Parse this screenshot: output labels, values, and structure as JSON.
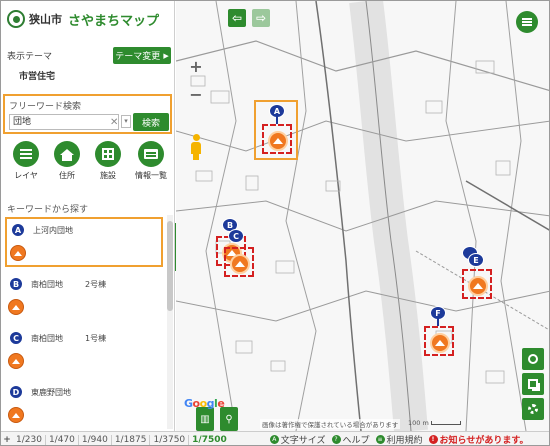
{
  "header": {
    "city_name": "狭山市",
    "map_name": "さやまちマップ"
  },
  "theme": {
    "label": "表示テーマ",
    "value": "市営住宅",
    "change_button": "テーマ変更"
  },
  "search": {
    "title": "フリーワード検索",
    "value": "団地",
    "button": "検索"
  },
  "nav": {
    "items": [
      {
        "label": "レイヤ",
        "icon": "layers-icon"
      },
      {
        "label": "住所",
        "icon": "house-icon"
      },
      {
        "label": "施設",
        "icon": "building-icon"
      },
      {
        "label": "情報一覧",
        "icon": "list-icon"
      }
    ]
  },
  "keyword": {
    "title": "キーワードから探す",
    "results": [
      {
        "marker": "A",
        "name": "上河内団地",
        "number": ""
      },
      {
        "marker": "B",
        "name": "南柏団地",
        "number": "2号棟"
      },
      {
        "marker": "C",
        "name": "南柏団地",
        "number": "1号棟"
      },
      {
        "marker": "D",
        "name": "東鹿野団地",
        "number": ""
      }
    ]
  },
  "map": {
    "markers": [
      "A",
      "B",
      "C",
      "E",
      "F"
    ],
    "google_logo": "Google",
    "attribution": "画像は著作権で保護されている場合があります",
    "scale_text": "100 m"
  },
  "status": {
    "scales": [
      "1/230",
      "1/470",
      "1/940",
      "1/1875",
      "1/3750",
      "1/7500"
    ],
    "active_scale": "1/7500",
    "font_size_link": "文字サイズ",
    "help_link": "ヘルプ",
    "terms_link": "利用規約",
    "notice_link": "お知らせがあります。"
  },
  "colors": {
    "brand_green": "#2e8b2e",
    "highlight_orange": "#f0a030",
    "marker_blue": "#1d3a9a",
    "marker_red": "#d42020"
  }
}
